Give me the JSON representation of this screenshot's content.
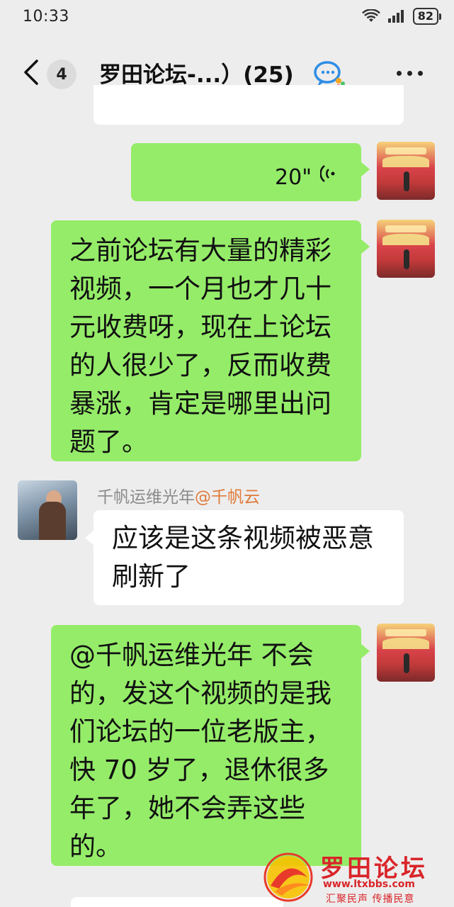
{
  "status_bar": {
    "time": "10:33",
    "battery": "82"
  },
  "header": {
    "unread_count": "4",
    "title": "罗田论坛-...）(25)"
  },
  "messages": [
    {
      "from": "self",
      "type": "voice",
      "duration": "20\""
    },
    {
      "from": "self",
      "type": "text",
      "lines": [
        "之前论坛有大量的精彩",
        "视频，一个月也才几十",
        "元收费呀，现在上论坛",
        "的人很少了，反而收费",
        "暴涨，肯定是哪里出问",
        "题了。"
      ]
    },
    {
      "from": "other",
      "sender": "千帆运维光年",
      "sender_mention": "@千帆云",
      "type": "text",
      "lines": [
        "应该是这条视频被恶意",
        "刷新了"
      ]
    },
    {
      "from": "self",
      "type": "text",
      "lines": [
        "@千帆运维光年  不会",
        "的，发这个视频的是我",
        "们论坛的一位老版主，",
        "快 70 岁了，退休很多",
        "年了，她不会弄这些",
        "的。"
      ]
    }
  ],
  "watermark": {
    "title": "罗田论坛",
    "url": "www.ltxbbs.com",
    "slogan": "汇聚民声  传播民意"
  },
  "colors": {
    "background": "#ededed",
    "self_bubble": "#95ec69",
    "other_bubble": "#ffffff",
    "mention": "#e07a3a",
    "watermark": "#d9252a"
  }
}
